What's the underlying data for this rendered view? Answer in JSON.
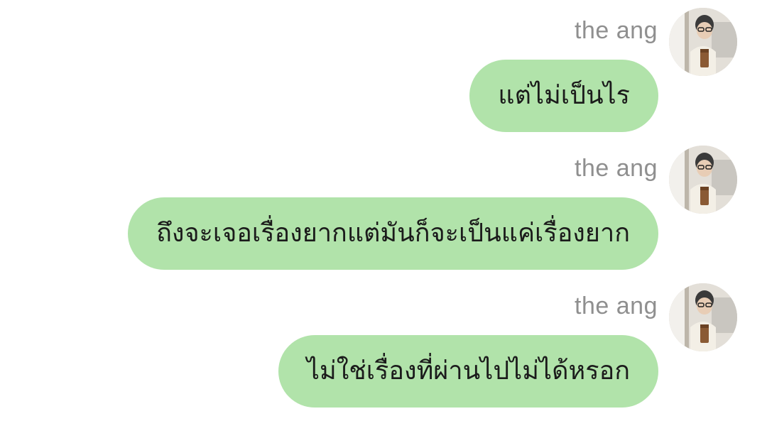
{
  "messages": [
    {
      "sender": "the ang",
      "text": "แต่ไม่เป็นไร"
    },
    {
      "sender": "the ang",
      "text": "ถึงจะเจอเรื่องยากแต่มันก็จะเป็นแค่เรื่องยาก"
    },
    {
      "sender": "the ang",
      "text": "ไม่ใช่เรื่องที่ผ่านไปไม่ได้หรอก"
    }
  ],
  "colors": {
    "bubble": "#b1e3aa",
    "sender_name": "#8f8f8f",
    "background": "#ffffff"
  }
}
